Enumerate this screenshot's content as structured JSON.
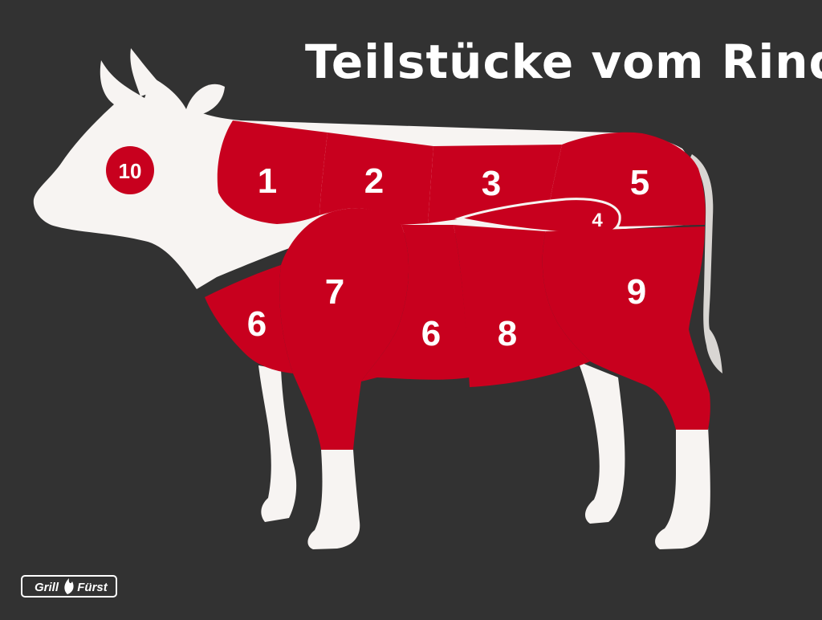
{
  "title": "Teilstücke vom Rind",
  "cuts": [
    {
      "id": "neck",
      "label": "1"
    },
    {
      "id": "prime-rib",
      "label": "2"
    },
    {
      "id": "strip-loin",
      "label": "3"
    },
    {
      "id": "tenderloin",
      "label": "4"
    },
    {
      "id": "rump",
      "label": "5"
    },
    {
      "id": "brisket",
      "label": "6"
    },
    {
      "id": "shoulder",
      "label": "7"
    },
    {
      "id": "flank",
      "label": "6"
    },
    {
      "id": "belly",
      "label": "8"
    },
    {
      "id": "round",
      "label": "9"
    },
    {
      "id": "head",
      "label": "10"
    }
  ],
  "logo": {
    "left": "Grill",
    "right": "Fürst"
  },
  "colors": {
    "background": "#323232",
    "cow": "#f7f4f2",
    "meat": "#c8001e",
    "tail": "#d9d6d3",
    "text": "#ffffff"
  }
}
